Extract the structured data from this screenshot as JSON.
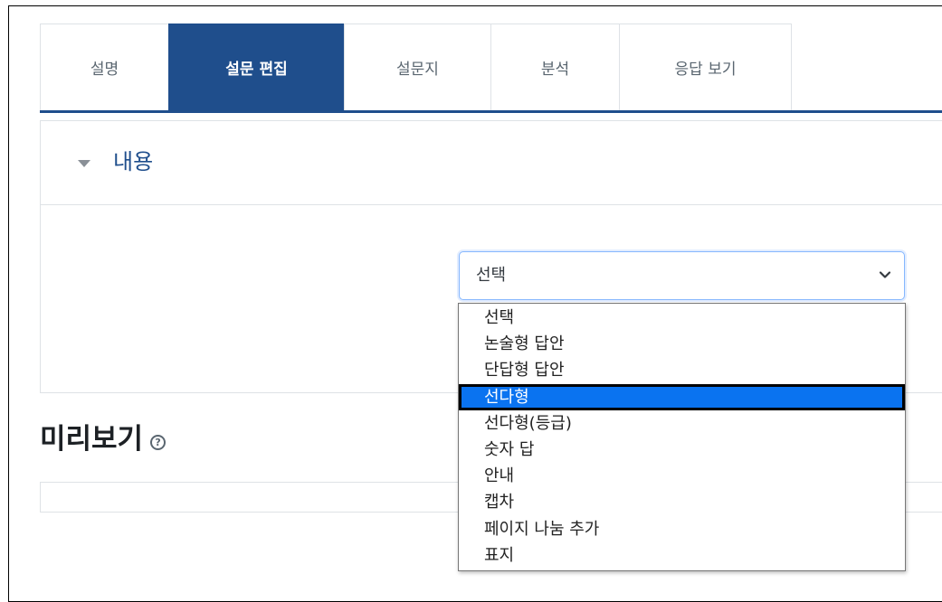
{
  "tabs": [
    {
      "label": "설명",
      "active": false
    },
    {
      "label": "설문 편집",
      "active": true
    },
    {
      "label": "설문지",
      "active": false
    },
    {
      "label": "분석",
      "active": false
    },
    {
      "label": "응답 보기",
      "active": false
    }
  ],
  "section": {
    "legend": "내용"
  },
  "question_type_select": {
    "value": "선택",
    "options": [
      "선택",
      "논술형 답안",
      "단답형 답안",
      "선다형",
      "선다형(등급)",
      "숫자 답",
      "안내",
      "캡차",
      "페이지 나눔 추가",
      "표지"
    ],
    "highlighted_option": "선다형"
  },
  "preview": {
    "title": "미리보기",
    "help_icon_glyph": "?"
  },
  "colors": {
    "accent": "#1f4e8c",
    "highlight": "#0a73f0"
  },
  "icons": {
    "collapse": "caret-down-icon",
    "select": "chevron-down-icon",
    "help": "question-circle-icon"
  }
}
